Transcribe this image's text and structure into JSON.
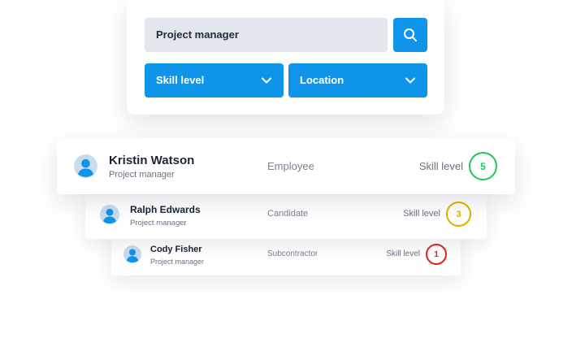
{
  "search": {
    "value": "Project manager",
    "accent_color": "#0e95ea"
  },
  "filters": [
    {
      "label": "Skill level"
    },
    {
      "label": "Location"
    }
  ],
  "candidates": [
    {
      "name": "Kristin Watson",
      "role": "Project manager",
      "type": "Employee",
      "skill_label": "Skill level",
      "skill_value": "5",
      "skill_color": "#22c55e"
    },
    {
      "name": "Ralph Edwards",
      "role": "Project manager",
      "type": "Candidate",
      "skill_label": "Skill level",
      "skill_value": "3",
      "skill_color": "#e0b000"
    },
    {
      "name": "Cody Fisher",
      "role": "Project manager",
      "type": "Subcontractor",
      "skill_label": "Skill level",
      "skill_value": "1",
      "skill_color": "#dc2626"
    }
  ]
}
